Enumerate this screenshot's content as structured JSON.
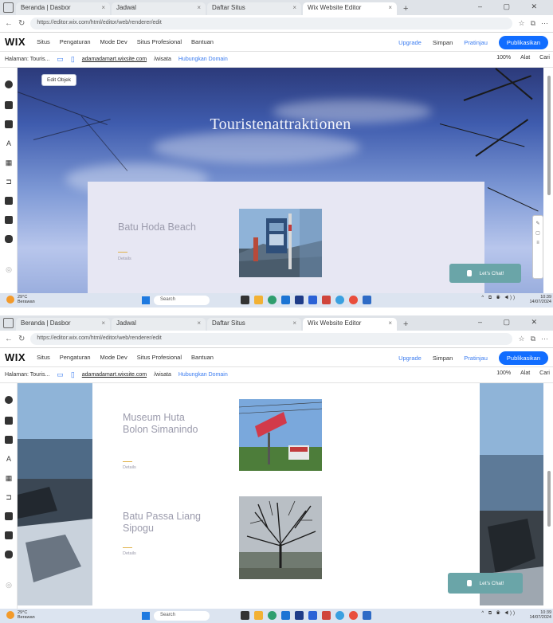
{
  "screens": [
    {
      "tabs": [
        "Beranda | Dasbor",
        "Jadwal",
        "Daftar Situs",
        "Wix Website Editor"
      ],
      "url": "https://editor.wix.com/html/editor/web/renderer/edit",
      "wix": {
        "logo": "WIX",
        "menu": [
          "Situs",
          "Pengaturan",
          "Mode Dev",
          "Situs Profesional",
          "Bantuan"
        ],
        "upgrade": "Upgrade",
        "save": "Simpan",
        "preview": "Pratinjau",
        "publish": "Publikasikan"
      },
      "editbar": {
        "page": "Halaman: Touris...",
        "domain": "adamadamart.wixsite.com",
        "site": "/wisata",
        "connect_domain": "Hubungkan Domain",
        "zoom": "100%",
        "tools": "Alat",
        "search": "Cari"
      },
      "hero": {
        "kicker": "",
        "title": "Touristenattraktionen"
      },
      "edit_chip": "Edit Objek",
      "items": [
        {
          "title": "Batu Hoda Beach",
          "sub": "Details"
        }
      ],
      "chat": "Let's Chat!"
    },
    {
      "tabs": [
        "Beranda | Dasbor",
        "Jadwal",
        "Daftar Situs",
        "Wix Website Editor"
      ],
      "url": "https://editor.wix.com/html/editor/web/renderer/edit",
      "wix": {
        "logo": "WIX",
        "menu": [
          "Situs",
          "Pengaturan",
          "Mode Dev",
          "Situs Profesional",
          "Bantuan"
        ],
        "upgrade": "Upgrade",
        "save": "Simpan",
        "preview": "Pratinjau",
        "publish": "Publikasikan"
      },
      "editbar": {
        "page": "Halaman: Touris...",
        "domain": "adamadamart.wixsite.com",
        "site": "/wisata",
        "connect_domain": "Hubungkan Domain",
        "zoom": "100%",
        "tools": "Alat",
        "search": "Cari"
      },
      "items": [
        {
          "title": "Museum Huta Bolon Simanindo",
          "sub": "Details"
        },
        {
          "title": "Batu Passa Liang Sipogu",
          "sub": "Details"
        }
      ],
      "chat": "Let's Chat!"
    }
  ],
  "taskbar": {
    "search": "Search",
    "weather": "29°C",
    "weather_desc": "Berawan",
    "time": "10:39",
    "date": "14/07/2024"
  },
  "colors": {
    "publish": "#116dff",
    "chat": "#6aa5a8",
    "card": "#e7e7f3",
    "accent_rule": "#e0b24a"
  }
}
